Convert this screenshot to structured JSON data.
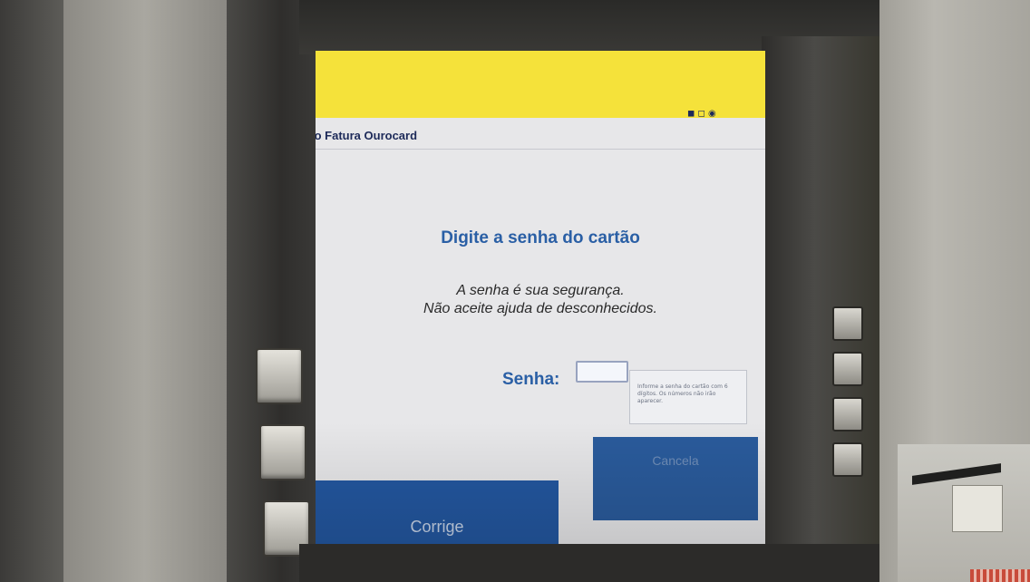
{
  "screen": {
    "header_title": "rato Fatura Ourocard",
    "prompt_title": "Digite a senha do cartão",
    "warning_line_1": "A senha é sua segurança.",
    "warning_line_2": "Não aceite ajuda de desconhecidos.",
    "password_label": "Senha:",
    "password_value": "",
    "hint_text": "Informe a senha do cartão com 6 dígitos. Os números não irão aparecer.",
    "buttons": {
      "cancel_label": "Cancela",
      "correct_label": "Corrige"
    }
  },
  "colors": {
    "brand_yellow": "#f5e23a",
    "brand_blue": "#2a5fa5",
    "button_blue": "#2357a0"
  }
}
